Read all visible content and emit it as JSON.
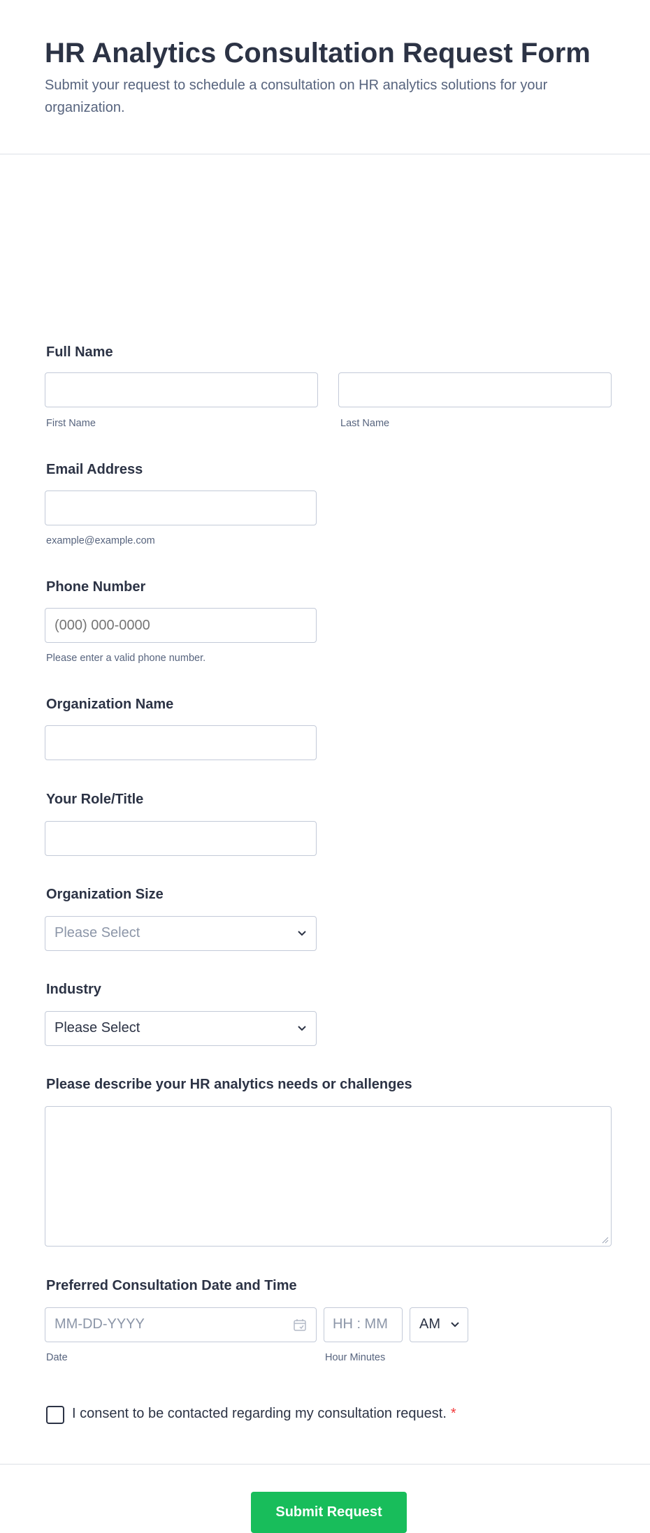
{
  "header": {
    "title": "HR Analytics Consultation Request Form",
    "subtitle": "Submit your request to schedule a consultation on HR analytics solutions for your organization."
  },
  "fields": {
    "full_name": {
      "label": "Full Name",
      "first_sublabel": "First Name",
      "last_sublabel": "Last Name"
    },
    "email": {
      "label": "Email Address",
      "sublabel": "example@example.com"
    },
    "phone": {
      "label": "Phone Number",
      "placeholder": "(000) 000-0000",
      "sublabel": "Please enter a valid phone number."
    },
    "organization": {
      "label": "Organization Name"
    },
    "role": {
      "label": "Your Role/Title"
    },
    "org_size": {
      "label": "Organization Size",
      "value": "Please Select"
    },
    "industry": {
      "label": "Industry",
      "value": "Please Select"
    },
    "needs": {
      "label": "Please describe your HR analytics needs or challenges"
    },
    "datetime": {
      "label": "Preferred Consultation Date and Time",
      "date_placeholder": "MM-DD-YYYY",
      "time_placeholder": "HH : MM",
      "ampm": "AM",
      "date_sublabel": "Date",
      "time_sublabel": "Hour Minutes"
    },
    "consent": {
      "label": "I consent to be contacted regarding my consultation request.",
      "required_mark": "*"
    }
  },
  "submit": {
    "label": "Submit Request"
  },
  "colors": {
    "accent": "#18bd5b",
    "required": "#f23a3c",
    "text": "#2c3345",
    "muted": "#57647e"
  }
}
